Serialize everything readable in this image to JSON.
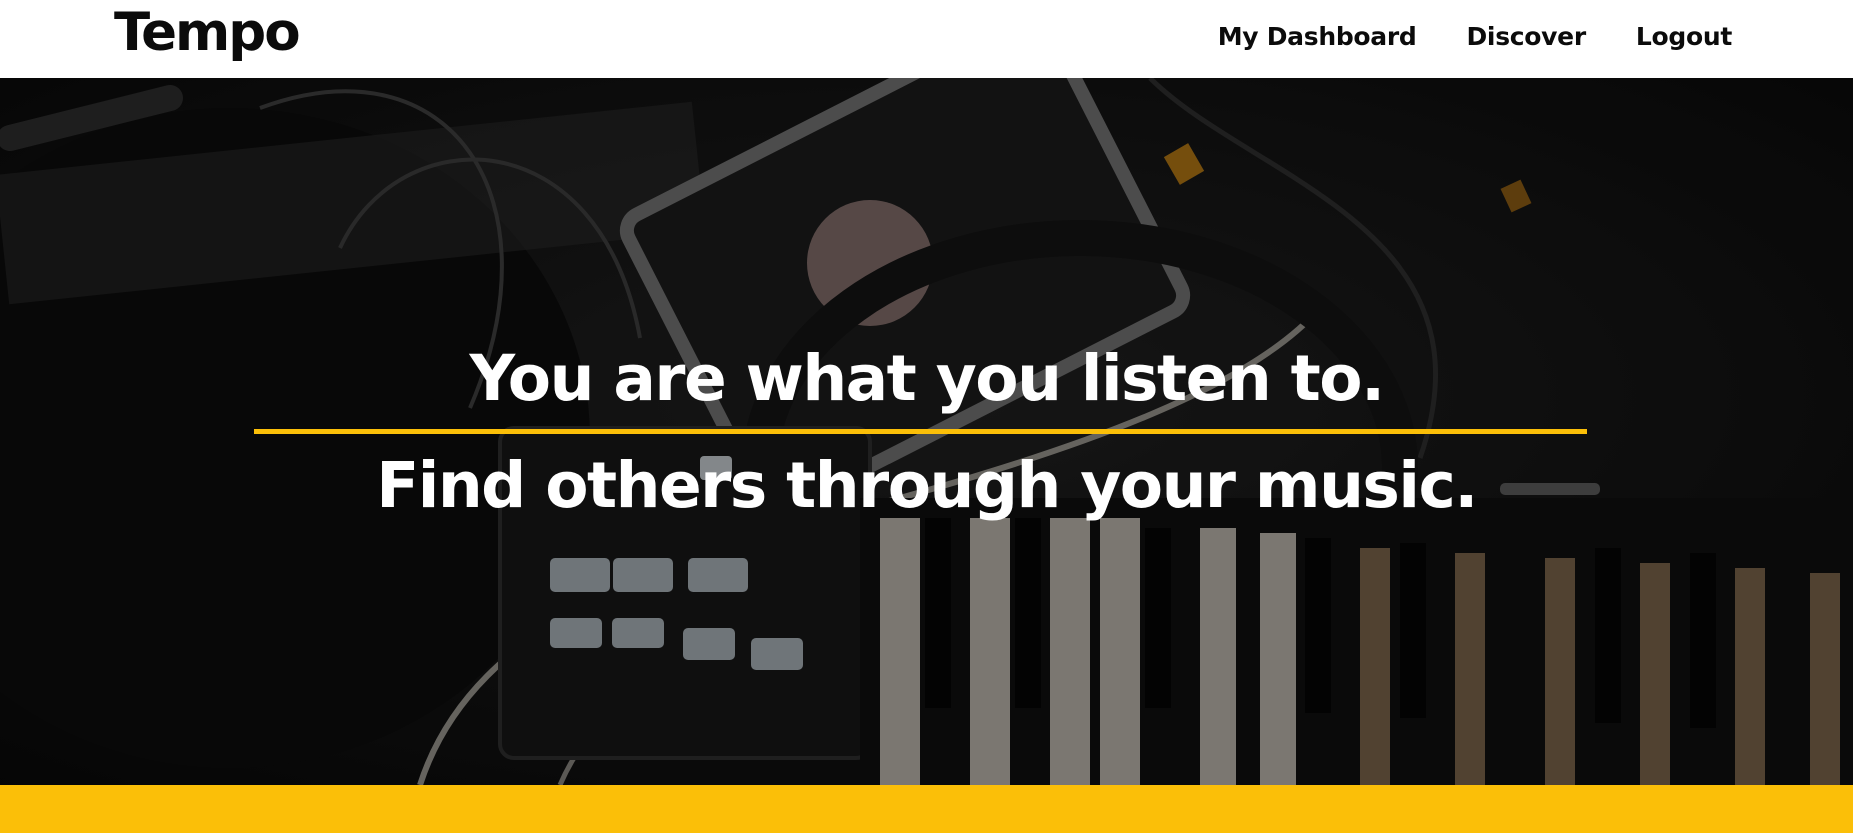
{
  "brand": {
    "name": "Tempo"
  },
  "nav": {
    "links": [
      {
        "label": "My Dashboard"
      },
      {
        "label": "Discover"
      },
      {
        "label": "Logout"
      }
    ]
  },
  "hero": {
    "headline": "You are what you listen to.",
    "subheadline": "Find others through your music.",
    "image_subject": "music-gear-background"
  },
  "colors": {
    "accent": "#fbbf08",
    "text_dark": "#0b0b0b",
    "hero_text": "#ffffff",
    "background": "#ffffff"
  }
}
